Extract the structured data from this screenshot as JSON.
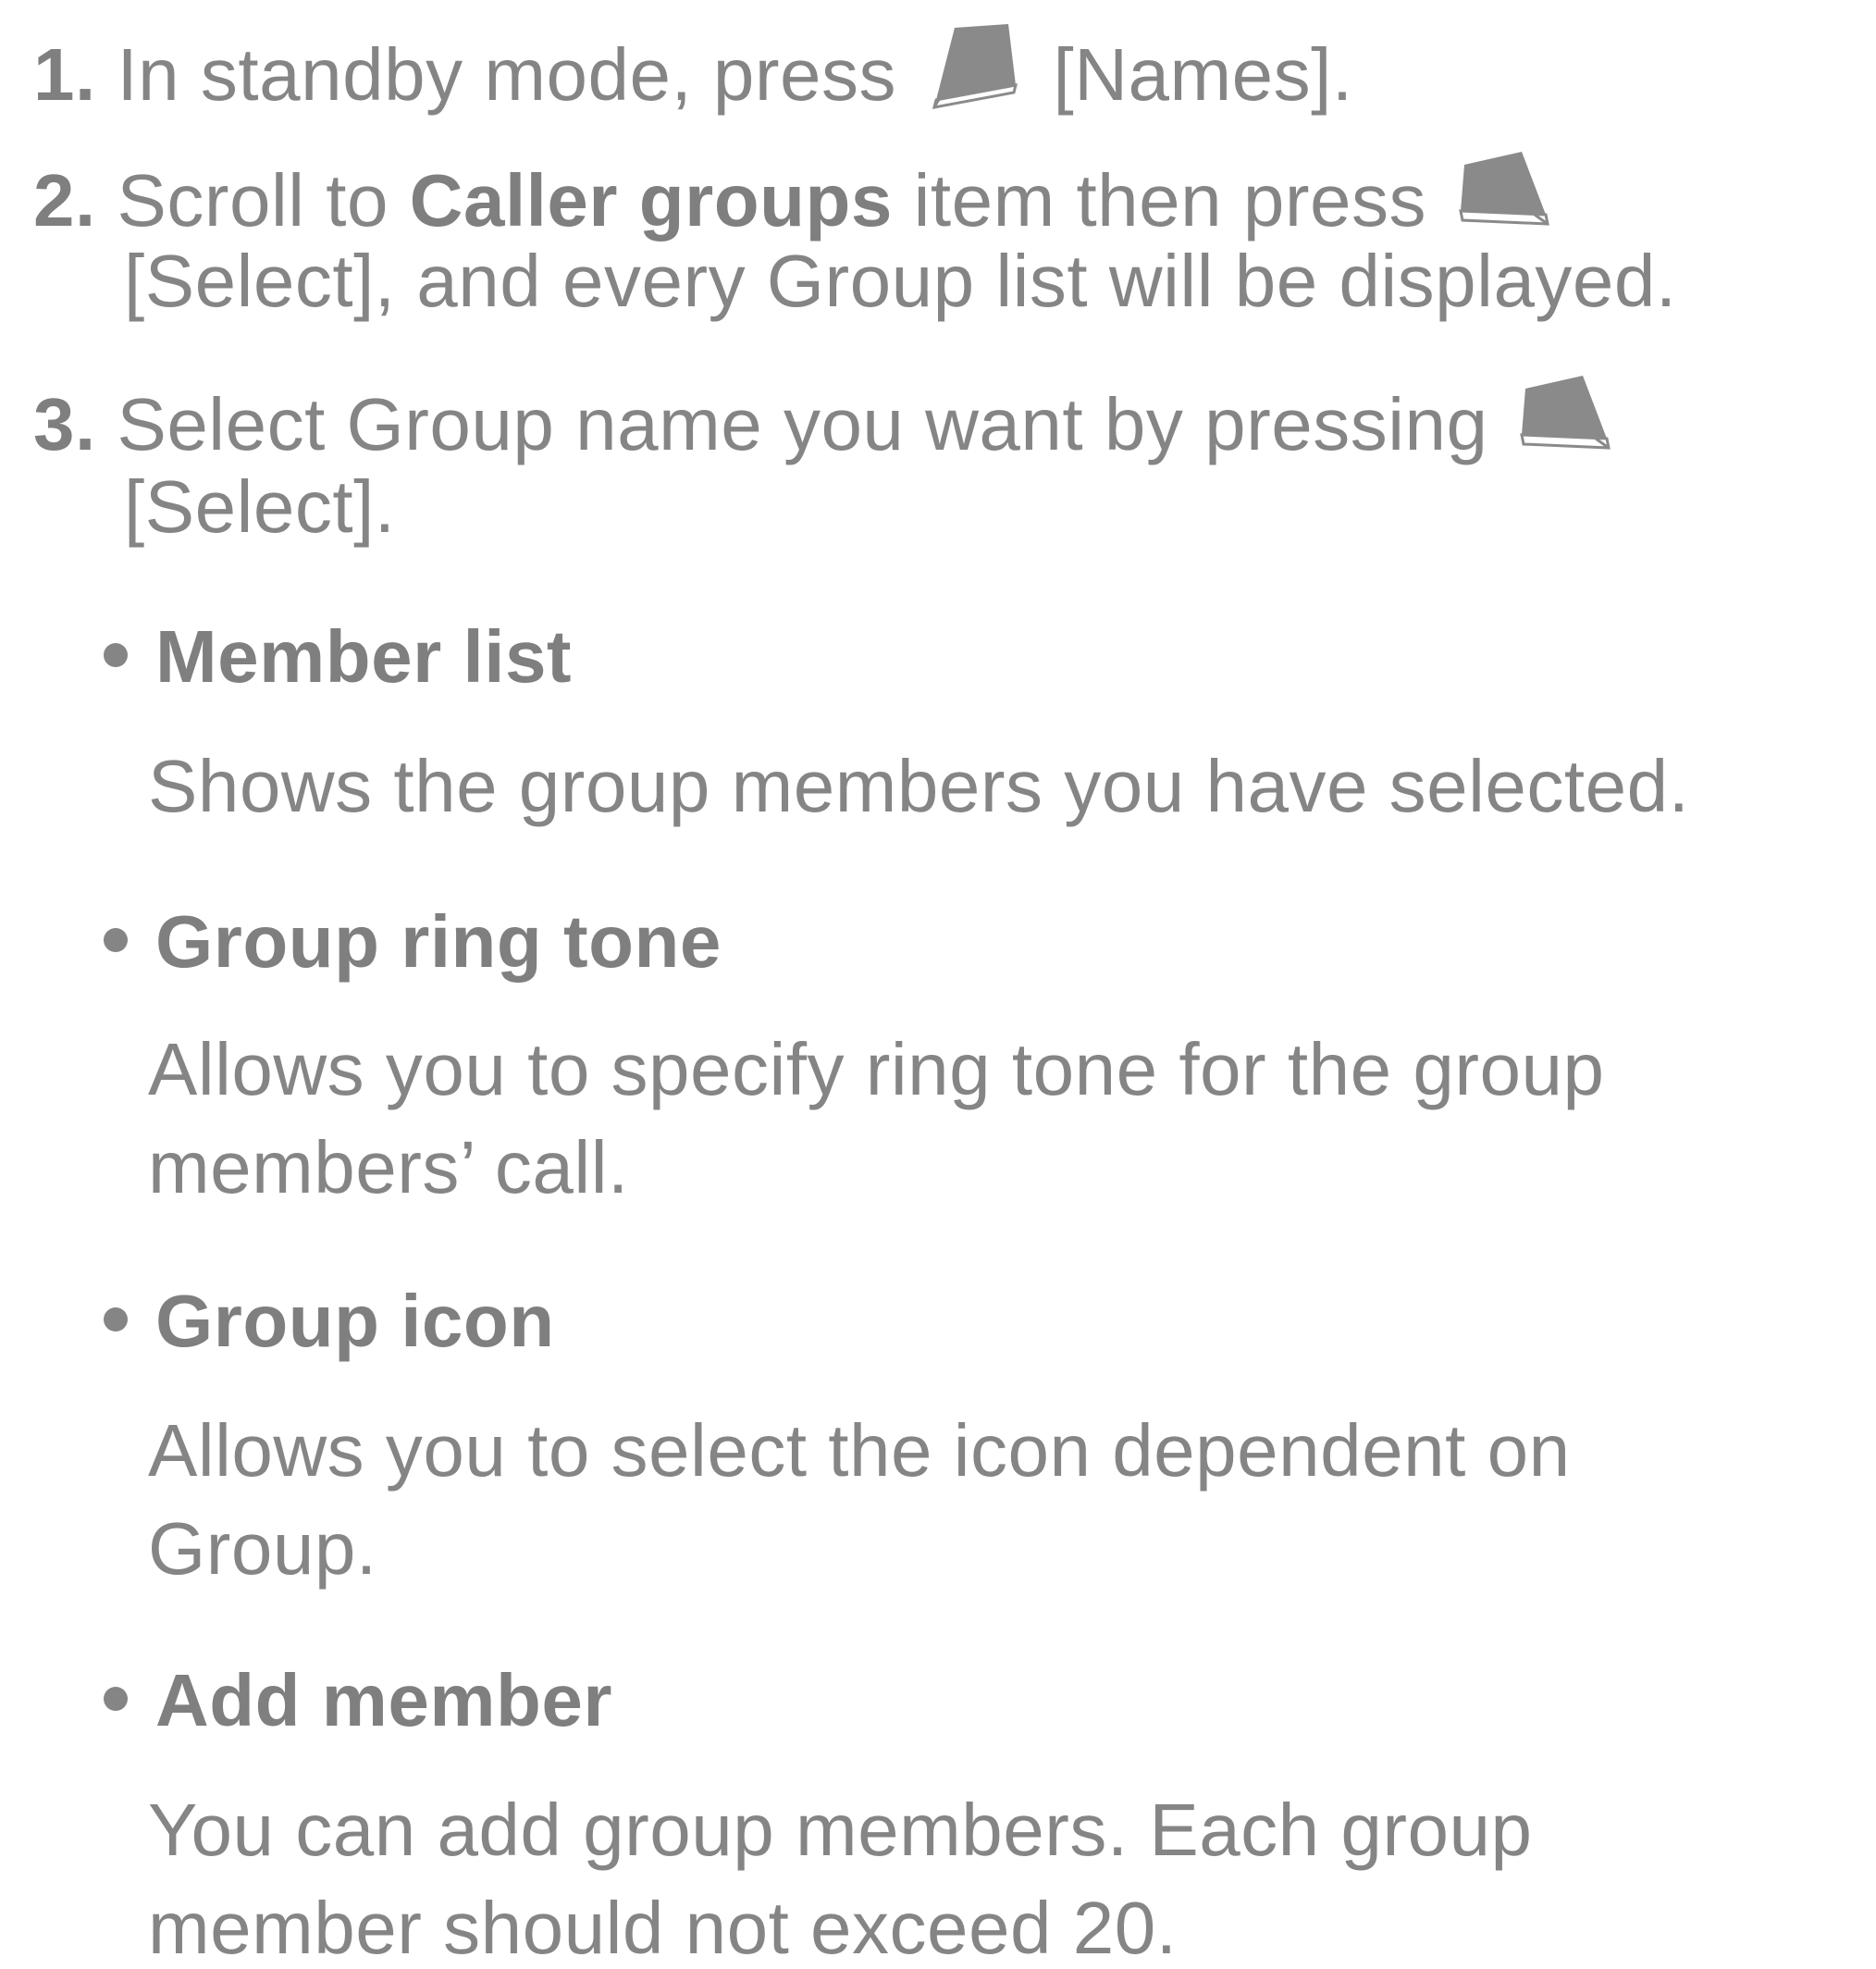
{
  "steps": [
    {
      "number": "1.",
      "line1_before": "In standby mode, press",
      "line1_after": "[Names].",
      "key_icon": "left-softkey-icon"
    },
    {
      "number": "2.",
      "line1_before": "Scroll to",
      "line1_bold": "Caller groups",
      "line1_after": "item then press",
      "line2": "[Select], and every Group list will be displayed.",
      "key_icon": "right-softkey-icon"
    },
    {
      "number": "3.",
      "line1_before": "Select Group name you want by pressing",
      "line2": "[Select].",
      "key_icon": "right-softkey-icon"
    }
  ],
  "options": [
    {
      "title": "Member list",
      "desc_line1": "Shows the group members you have selected."
    },
    {
      "title": "Group ring tone",
      "desc_line1": "Allows you to specify ring tone for the group",
      "desc_line2": "members’ call."
    },
    {
      "title": "Group icon",
      "desc_line1": "Allows you to select the icon dependent on",
      "desc_line2": "Group."
    },
    {
      "title": "Add member",
      "desc_line1": "You can add group members. Each group",
      "desc_line2": "member should not exceed 20."
    }
  ],
  "colors": {
    "text": "#858585",
    "icon_fill": "#8a8a8a"
  }
}
